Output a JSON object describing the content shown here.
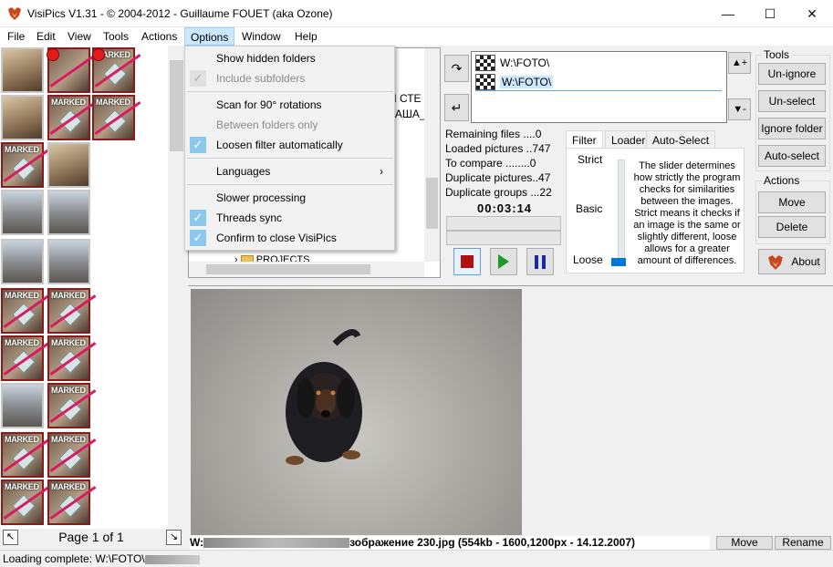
{
  "window": {
    "title": "VisiPics V1.31 - © 2004-2012 - Guillaume FOUET (aka Ozone)",
    "minimize_icon": "minimize-icon",
    "maximize_icon": "maximize-icon",
    "close_icon": "close-icon"
  },
  "menu": [
    "File",
    "Edit",
    "View",
    "Tools",
    "Actions",
    "Options",
    "Window",
    "Help"
  ],
  "thumbnails": {
    "marked_label": "MARKED",
    "pager": {
      "label": "Page 1 of 1"
    }
  },
  "options_menu": {
    "items": [
      {
        "label": "Show hidden folders",
        "checked": false,
        "disabled": false
      },
      {
        "label": "Include subfolders",
        "checked": true,
        "disabled": true
      },
      {
        "label": "Scan for 90° rotations",
        "checked": false,
        "disabled": false
      },
      {
        "label": "Between folders only",
        "checked": false,
        "disabled": true
      },
      {
        "label": "Loosen filter automatically",
        "checked": true,
        "disabled": false
      },
      {
        "label": "Languages",
        "submenu": true
      },
      {
        "label": "Slower processing",
        "checked": false,
        "disabled": false
      },
      {
        "label": "Threads sync",
        "checked": true,
        "disabled": false
      },
      {
        "label": "Confirm to close VisiPics",
        "checked": true,
        "disabled": false
      }
    ]
  },
  "tree": {
    "partial_1": "Й СТЕ",
    "partial_2": "ТАША_",
    "projects": "PROJECTS"
  },
  "folders": {
    "items": [
      "W:\\FOTO\\",
      "W:\\FOTO\\"
    ]
  },
  "stats": {
    "remaining": "Remaining files ....0",
    "loaded": "Loaded pictures ..747",
    "to_compare": "To compare ........0",
    "duplicates": "Duplicate pictures..47",
    "groups": "Duplicate groups ...22",
    "timer": "00:03:14"
  },
  "tabs": [
    "Filter",
    "Loader",
    "Auto-Select"
  ],
  "filter": {
    "strict": "Strict",
    "basic": "Basic",
    "loose": "Loose",
    "level": "loose",
    "description": "The slider determines how strictly the program checks for similarities between the images. Strict means it checks if an image is the same or slightly different, loose allows for a greater amount of differences."
  },
  "tools": {
    "title": "Tools",
    "buttons": [
      "Un-ignore",
      "Un-select",
      "Ignore folder",
      "Auto-select"
    ]
  },
  "actions": {
    "title": "Actions",
    "buttons": [
      "Move",
      "Delete"
    ],
    "about": "About"
  },
  "preview": {
    "caption_prefix": "W:",
    "caption_suffix": "зображение 230.jpg (554kb - 1600,1200px - 14.12.2007)",
    "move_button": "Move",
    "rename_button": "Rename"
  },
  "status": {
    "text": "Loading complete: W:\\FOTO\\"
  },
  "colors": {
    "accent": "#0078d7",
    "menu_highlight": "#cce8ff",
    "marked_border": "#8b1a1a"
  }
}
